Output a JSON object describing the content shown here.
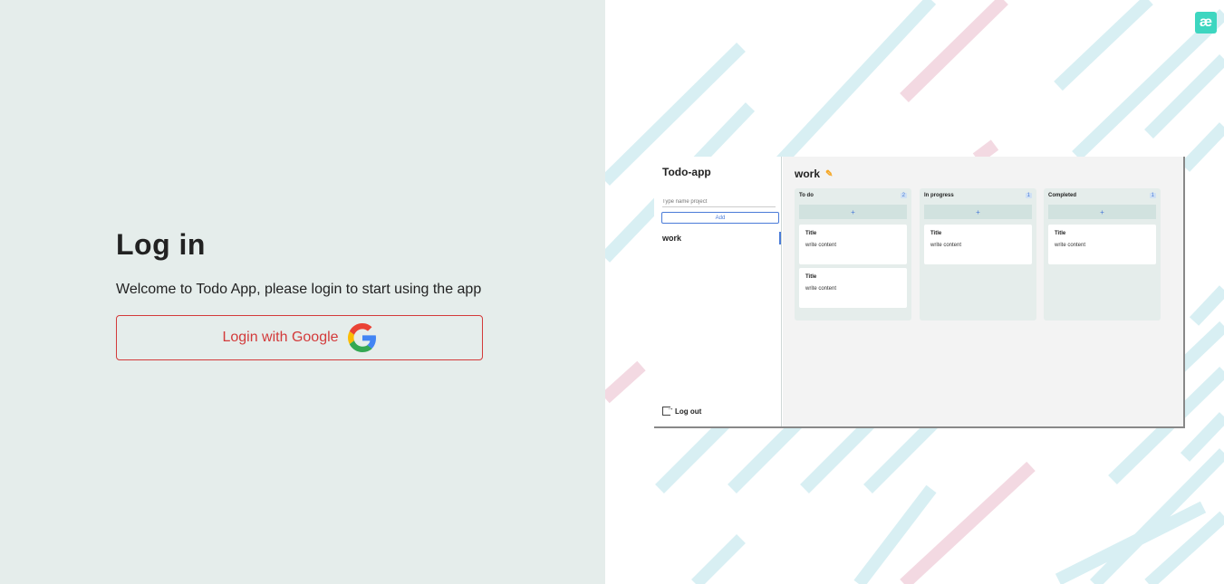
{
  "login": {
    "title": "Log in",
    "subtitle": "Welcome to Todo App, please login to start using the app",
    "button_label": "Login with Google"
  },
  "brand": {
    "logo_text": "æ",
    "accent": "#3dd6c0",
    "danger": "#d33a3a"
  },
  "preview": {
    "app_title": "Todo-app",
    "input_placeholder": "Type name project",
    "add_label": "Add",
    "projects": [
      "work"
    ],
    "logout_label": "Log out",
    "board_title": "work",
    "columns": [
      {
        "title": "To do",
        "count": "2",
        "cards": [
          {
            "title": "Title",
            "content": "write content"
          },
          {
            "title": "Title",
            "content": "write content"
          }
        ]
      },
      {
        "title": "In progress",
        "count": "1",
        "cards": [
          {
            "title": "Title",
            "content": "write content"
          }
        ]
      },
      {
        "title": "Completed",
        "count": "1",
        "cards": [
          {
            "title": "Title",
            "content": "write content"
          }
        ]
      }
    ],
    "plus_label": "+"
  }
}
